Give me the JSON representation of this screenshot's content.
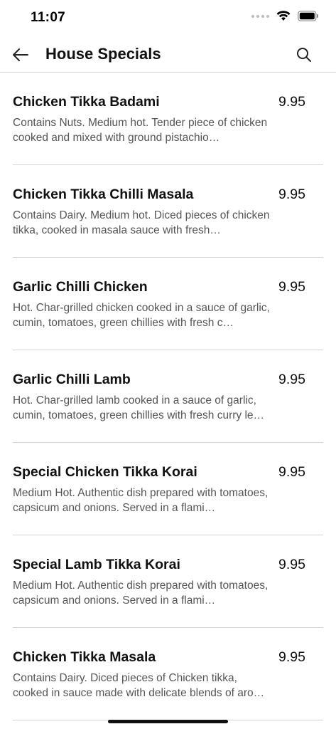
{
  "status_bar": {
    "time": "11:07"
  },
  "nav": {
    "title": "House Specials"
  },
  "menu_items": [
    {
      "name": "Chicken Tikka Badami",
      "price": "9.95",
      "description": "Contains Nuts. Medium hot. Tender piece of chicken cooked and mixed with ground pistachio…"
    },
    {
      "name": "Chicken Tikka Chilli Masala",
      "price": "9.95",
      "description": "Contains Dairy. Medium hot. Diced pieces of chicken tikka, cooked in masala sauce with fresh…"
    },
    {
      "name": "Garlic Chilli Chicken",
      "price": "9.95",
      "description": "Hot. Char-grilled chicken cooked in a sauce of garlic, cumin, tomatoes, green chillies with fresh c…"
    },
    {
      "name": "Garlic Chilli Lamb",
      "price": "9.95",
      "description": "Hot. Char-grilled lamb cooked in a sauce of garlic, cumin, tomatoes, green chillies with fresh curry le…"
    },
    {
      "name": "Special Chicken Tikka Korai",
      "price": "9.95",
      "description": "Medium Hot. Authentic dish prepared with tomatoes, capsicum and onions. Served in a flami…"
    },
    {
      "name": "Special Lamb Tikka Korai",
      "price": "9.95",
      "description": "Medium Hot. Authentic dish prepared with tomatoes, capsicum and onions. Served in a flami…"
    },
    {
      "name": "Chicken Tikka Masala",
      "price": "9.95",
      "description": "Contains Dairy. Diced pieces of Chicken tikka, cooked in sauce made with delicate blends of aro…"
    }
  ],
  "icons": {
    "back": "arrow-left-icon",
    "search": "search-icon",
    "signal": "cellular-signal-icon",
    "wifi": "wifi-icon",
    "battery": "battery-icon"
  }
}
